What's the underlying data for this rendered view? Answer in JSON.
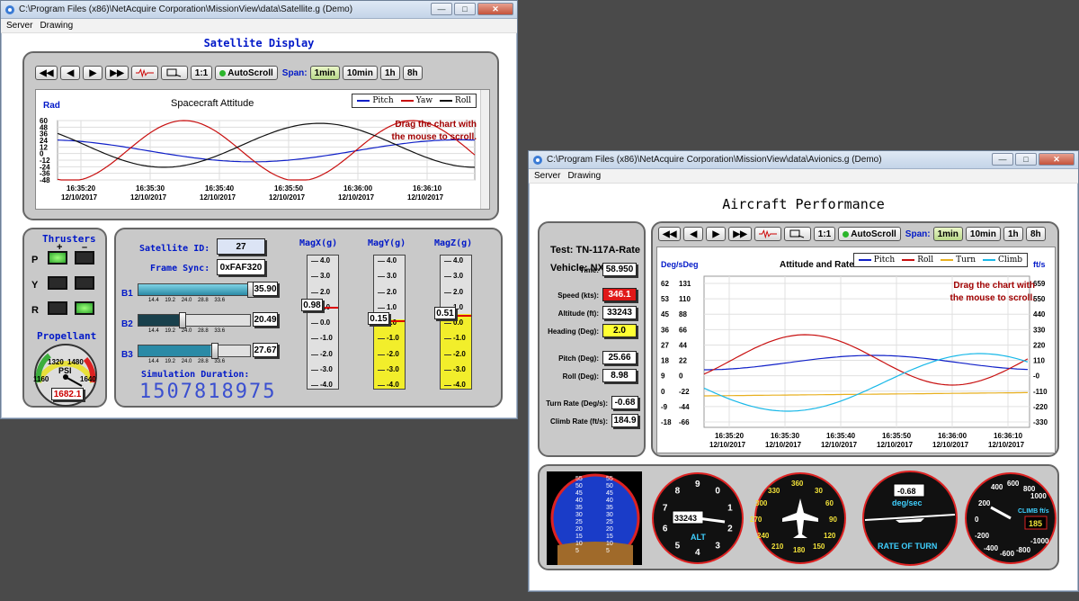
{
  "satellite_window": {
    "title": "C:\\Program Files (x86)\\NetAcquire Corporation\\MissionView\\data\\Satellite.g (Demo)",
    "menu": [
      "Server",
      "Drawing"
    ],
    "heading": "Satellite Display",
    "toolbar": {
      "btn_11": "1:1",
      "autoscroll": "AutoScroll",
      "span_label": "Span:",
      "spans": [
        "1min",
        "10min",
        "1h",
        "8h"
      ]
    },
    "chart_data": {
      "type": "line",
      "title": "Spacecraft Attitude",
      "ylabel": "Rad",
      "ylim": [
        -48,
        60
      ],
      "yticks": [
        "60",
        "48",
        "36",
        "24",
        "12",
        "0",
        "-12",
        "-24",
        "-36",
        "-48"
      ],
      "xticks": [
        {
          "time": "16:35:20",
          "date": "12/10/2017"
        },
        {
          "time": "16:35:30",
          "date": "12/10/2017"
        },
        {
          "time": "16:35:40",
          "date": "12/10/2017"
        },
        {
          "time": "16:35:50",
          "date": "12/10/2017"
        },
        {
          "time": "16:36:00",
          "date": "12/10/2017"
        },
        {
          "time": "16:36:10",
          "date": "12/10/2017"
        }
      ],
      "series": [
        {
          "name": "Pitch",
          "color": "#1020c8",
          "amp": 20,
          "period": 60,
          "phase": 0.2,
          "offset": 5
        },
        {
          "name": "Yaw",
          "color": "#c81010",
          "amp": 55,
          "period": 33,
          "phase": 2.8,
          "offset": 5
        },
        {
          "name": "Roll",
          "color": "#111111",
          "amp": 40,
          "period": 45,
          "phase": 1.0,
          "offset": 15
        }
      ],
      "hint": [
        "Drag the chart with",
        "the mouse to scroll."
      ]
    },
    "thrusters": {
      "title": "Thrusters",
      "plus": "+",
      "minus": "–",
      "rows": [
        "P",
        "Y",
        "R"
      ],
      "states": [
        [
          true,
          false
        ],
        [
          false,
          false
        ],
        [
          false,
          true
        ]
      ]
    },
    "propellant": {
      "title": "Propellant",
      "unit": "PSI",
      "ticks": [
        "1160",
        "1320",
        "1480",
        "1640"
      ],
      "value": "1682.1"
    },
    "satellite_id": {
      "label": "Satellite ID:",
      "value": "27"
    },
    "frame_sync": {
      "label": "Frame Sync:",
      "value": "0xFAF320"
    },
    "sliders": [
      {
        "label": "B1",
        "value": "35.90",
        "fraction": 0.99,
        "ticks": "14.4 19.2 24.0 28.8 33.6"
      },
      {
        "label": "B2",
        "value": "20.49",
        "fraction": 0.4,
        "ticks": "14.4 19.2 24.0 28.8 33.6"
      },
      {
        "label": "B3",
        "value": "27.67",
        "fraction": 0.65,
        "ticks": "14.4 19.2 24.0 28.8 33.6"
      }
    ],
    "sim_duration": {
      "label": "Simulation Duration:",
      "value": "1507818975"
    },
    "mag": [
      {
        "title": "MagX(g)",
        "value": "0.98",
        "fraction": 0.62,
        "fill": false
      },
      {
        "title": "MagY(g)",
        "value": "0.15",
        "fraction": 0.52,
        "fill": true
      },
      {
        "title": "MagZ(g)",
        "value": "0.51",
        "fraction": 0.56,
        "fill": true
      }
    ],
    "mag_ticks": [
      "4.0",
      "3.0",
      "2.0",
      "1.0",
      "0.0",
      "-1.0",
      "-2.0",
      "-3.0",
      "-4.0"
    ]
  },
  "avionics_window": {
    "title": "C:\\Program Files (x86)\\NetAcquire Corporation\\MissionView\\data\\Avionics.g (Demo)",
    "menu": [
      "Server",
      "Drawing"
    ],
    "heading": "Aircraft Performance",
    "test": "Test: TN-117A-Rate",
    "vehicle": "Vehicle: NX-29331",
    "fields": [
      {
        "label": "Time:",
        "value": "58.950",
        "bg": "#ffffff"
      },
      {
        "label": "Speed (kts):",
        "value": "346.1",
        "bg": "#e01818"
      },
      {
        "label": "Altitude (ft):",
        "value": "33243",
        "bg": "#ffffff"
      },
      {
        "label": "Heading (Deg):",
        "value": "2.0",
        "bg": "#ffff33"
      },
      {
        "label": "Pitch (Deg):",
        "value": "25.66",
        "bg": "#ffffff"
      },
      {
        "label": "Roll (Deg):",
        "value": "8.98",
        "bg": "#ffffff"
      },
      {
        "label": "Turn Rate (Deg/s):",
        "value": "-0.68",
        "bg": "#ffffff"
      },
      {
        "label": "Climb Rate (ft/s):",
        "value": "184.9",
        "bg": "#ffffff"
      }
    ],
    "toolbar": {
      "btn_11": "1:1",
      "autoscroll": "AutoScroll",
      "span_label": "Span:",
      "spans": [
        "1min",
        "10min",
        "1h",
        "8h"
      ]
    },
    "chart_data": {
      "type": "line",
      "title": "Attitude and Rates",
      "ylabel": "Deg/sDeg",
      "ylabel_right": "ft/s",
      "yticks_left1": [
        "62",
        "53",
        "45",
        "36",
        "27",
        "18",
        "9",
        "0",
        "-9",
        "-18"
      ],
      "yticks_left2": [
        "131",
        "110",
        "88",
        "66",
        "44",
        "22",
        "0",
        "-22",
        "-44",
        "-66"
      ],
      "yticks_right": [
        "659",
        "550",
        "440",
        "330",
        "220",
        "110",
        "-0",
        "-110",
        "-220",
        "-330"
      ],
      "xticks": [
        {
          "time": "16:35:20",
          "date": "12/10/2017"
        },
        {
          "time": "16:35:30",
          "date": "12/10/2017"
        },
        {
          "time": "16:35:40",
          "date": "12/10/2017"
        },
        {
          "time": "16:35:50",
          "date": "12/10/2017"
        },
        {
          "time": "16:36:00",
          "date": "12/10/2017"
        },
        {
          "time": "16:36:10",
          "date": "12/10/2017"
        }
      ],
      "series": [
        {
          "name": "Pitch",
          "color": "#1020c8"
        },
        {
          "name": "Roll",
          "color": "#c81010"
        },
        {
          "name": "Turn",
          "color": "#e8b020"
        },
        {
          "name": "Climb",
          "color": "#18b8e8"
        }
      ],
      "hint": [
        "Drag the chart with",
        "the mouse to scroll."
      ]
    },
    "instruments": {
      "horizon_ticks": [
        "55",
        "55",
        "50",
        "50",
        "45",
        "45",
        "40",
        "40",
        "35",
        "35",
        "30",
        "30",
        "25",
        "25",
        "20",
        "20",
        "15",
        "15",
        "10",
        "10",
        "5",
        "5"
      ],
      "alt": {
        "label": "ALT",
        "value": "33243",
        "digits": [
          "9",
          "0",
          "1",
          "2",
          "3",
          "4",
          "5",
          "6",
          "7",
          "8"
        ]
      },
      "heading": {
        "ticks": [
          "360",
          "330",
          "30",
          "300",
          "60",
          "270",
          "90",
          "240",
          "120",
          "210",
          "180",
          "150"
        ]
      },
      "turn": {
        "value": "-0.68",
        "unit": "deg/sec",
        "label": "RATE OF TURN"
      },
      "climb": {
        "label": "CLIMB ft/s",
        "value": "185",
        "ticks": [
          "400",
          "600",
          "800",
          "1000",
          "200",
          "0",
          "-200",
          "-400",
          "-600",
          "-800",
          "-1000"
        ]
      }
    }
  }
}
